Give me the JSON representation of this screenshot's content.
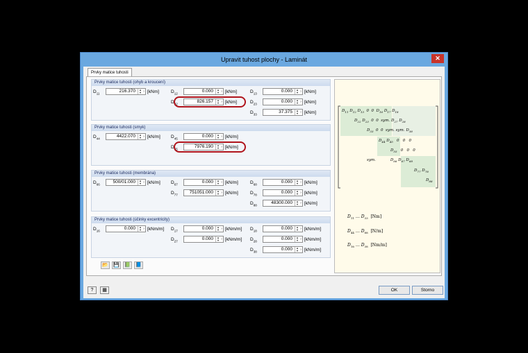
{
  "window": {
    "title": "Upravit tuhost plochy - Laminát",
    "close_glyph": "✕"
  },
  "tabs": [
    {
      "label": "Prvky matice tuhosti"
    }
  ],
  "groups": {
    "bending": "Prvky matice tuhosti (ohyb a kroucení)",
    "shear": "Prvky matice tuhosti (smyk)",
    "membrane": "Prvky matice tuhosti (membrána)",
    "eccentricity": "Prvky matice tuhosti (účinky excentricity)"
  },
  "fields": {
    "d11": {
      "label": "D",
      "sub": "11",
      "value": "216.370",
      "unit": "[kNm]"
    },
    "d12": {
      "label": "D",
      "sub": "12",
      "value": "0.000",
      "unit": "[kNm]"
    },
    "d13": {
      "label": "D",
      "sub": "13",
      "value": "0.000",
      "unit": "[kNm]"
    },
    "d22": {
      "label": "D",
      "sub": "22",
      "value": "826.157",
      "unit": "[kNm]"
    },
    "d23": {
      "label": "D",
      "sub": "23",
      "value": "0.000",
      "unit": "[kNm]"
    },
    "d33": {
      "label": "D",
      "sub": "33",
      "value": "37.375",
      "unit": "[kNm]"
    },
    "d44": {
      "label": "D",
      "sub": "44",
      "value": "4422.070",
      "unit": "[kN/m]"
    },
    "d45": {
      "label": "D",
      "sub": "45",
      "value": "0.000",
      "unit": "[kN/m]"
    },
    "d55": {
      "label": "D",
      "sub": "55",
      "value": "7976.190",
      "unit": "[kN/m]"
    },
    "d66": {
      "label": "D",
      "sub": "66",
      "value": "500/01.000",
      "unit": "[kN/m]"
    },
    "d67": {
      "label": "D",
      "sub": "67",
      "value": "0.000",
      "unit": "[kN/m]"
    },
    "d68": {
      "label": "D",
      "sub": "68",
      "value": "0.000",
      "unit": "[kN/m]"
    },
    "d77": {
      "label": "D",
      "sub": "77",
      "value": "751051.000",
      "unit": "[kN/m]"
    },
    "d78": {
      "label": "D",
      "sub": "78",
      "value": "0.000",
      "unit": "[kN/m]"
    },
    "d88": {
      "label": "D",
      "sub": "88",
      "value": "48300.000",
      "unit": "[kN/m]"
    },
    "d16": {
      "label": "D",
      "sub": "16",
      "value": "0.000",
      "unit": "[kNm/m]"
    },
    "d17": {
      "label": "D",
      "sub": "17",
      "value": "0.000",
      "unit": "[kNm/m]"
    },
    "d18": {
      "label": "D",
      "sub": "18",
      "value": "0.000",
      "unit": "[kNm/m]"
    },
    "d27": {
      "label": "D",
      "sub": "27",
      "value": "0.000",
      "unit": "[kNm/m]"
    },
    "d28": {
      "label": "D",
      "sub": "28",
      "value": "0.000",
      "unit": "[kNm/m]"
    },
    "d38": {
      "label": "D",
      "sub": "38",
      "value": "0.000",
      "unit": "[kNm/m]"
    }
  },
  "spinner": {
    "up": "▲",
    "down": "▼",
    "arrow": "›"
  },
  "matrix": {
    "r1": [
      "D",
      "11",
      "D",
      "12",
      "D",
      "13",
      "0",
      "0",
      "D",
      "16",
      "D",
      "17",
      "D",
      "18"
    ],
    "r2": [
      "D",
      "22",
      "D",
      "23",
      "0",
      "0",
      "sym.",
      "D",
      "27",
      "D",
      "28"
    ],
    "r3": [
      "D",
      "33",
      "0",
      "0",
      "sym.",
      "sym.",
      "D",
      "38"
    ],
    "r4": [
      "D",
      "44",
      "D",
      "45",
      "0",
      "0",
      "0"
    ],
    "r5": [
      "D",
      "55",
      "0",
      "0",
      "0"
    ],
    "r6": [
      "sym.",
      "D",
      "66",
      "D",
      "67",
      "D",
      "68"
    ],
    "r7": [
      "D",
      "77",
      "D",
      "78"
    ],
    "r8": [
      "D",
      "88"
    ]
  },
  "legend": [
    {
      "from": "11",
      "to": "33",
      "unit": "[Nm]"
    },
    {
      "from": "44",
      "to": "88",
      "unit": "[N/m]"
    },
    {
      "from": "16",
      "to": "38",
      "unit": "[Nm/m]"
    }
  ],
  "toolbar_icons": [
    "📂",
    "💾",
    "📗",
    "📘"
  ],
  "bottom_icons": [
    "?",
    "▦"
  ],
  "buttons": {
    "ok": "OK",
    "cancel": "Storno"
  }
}
